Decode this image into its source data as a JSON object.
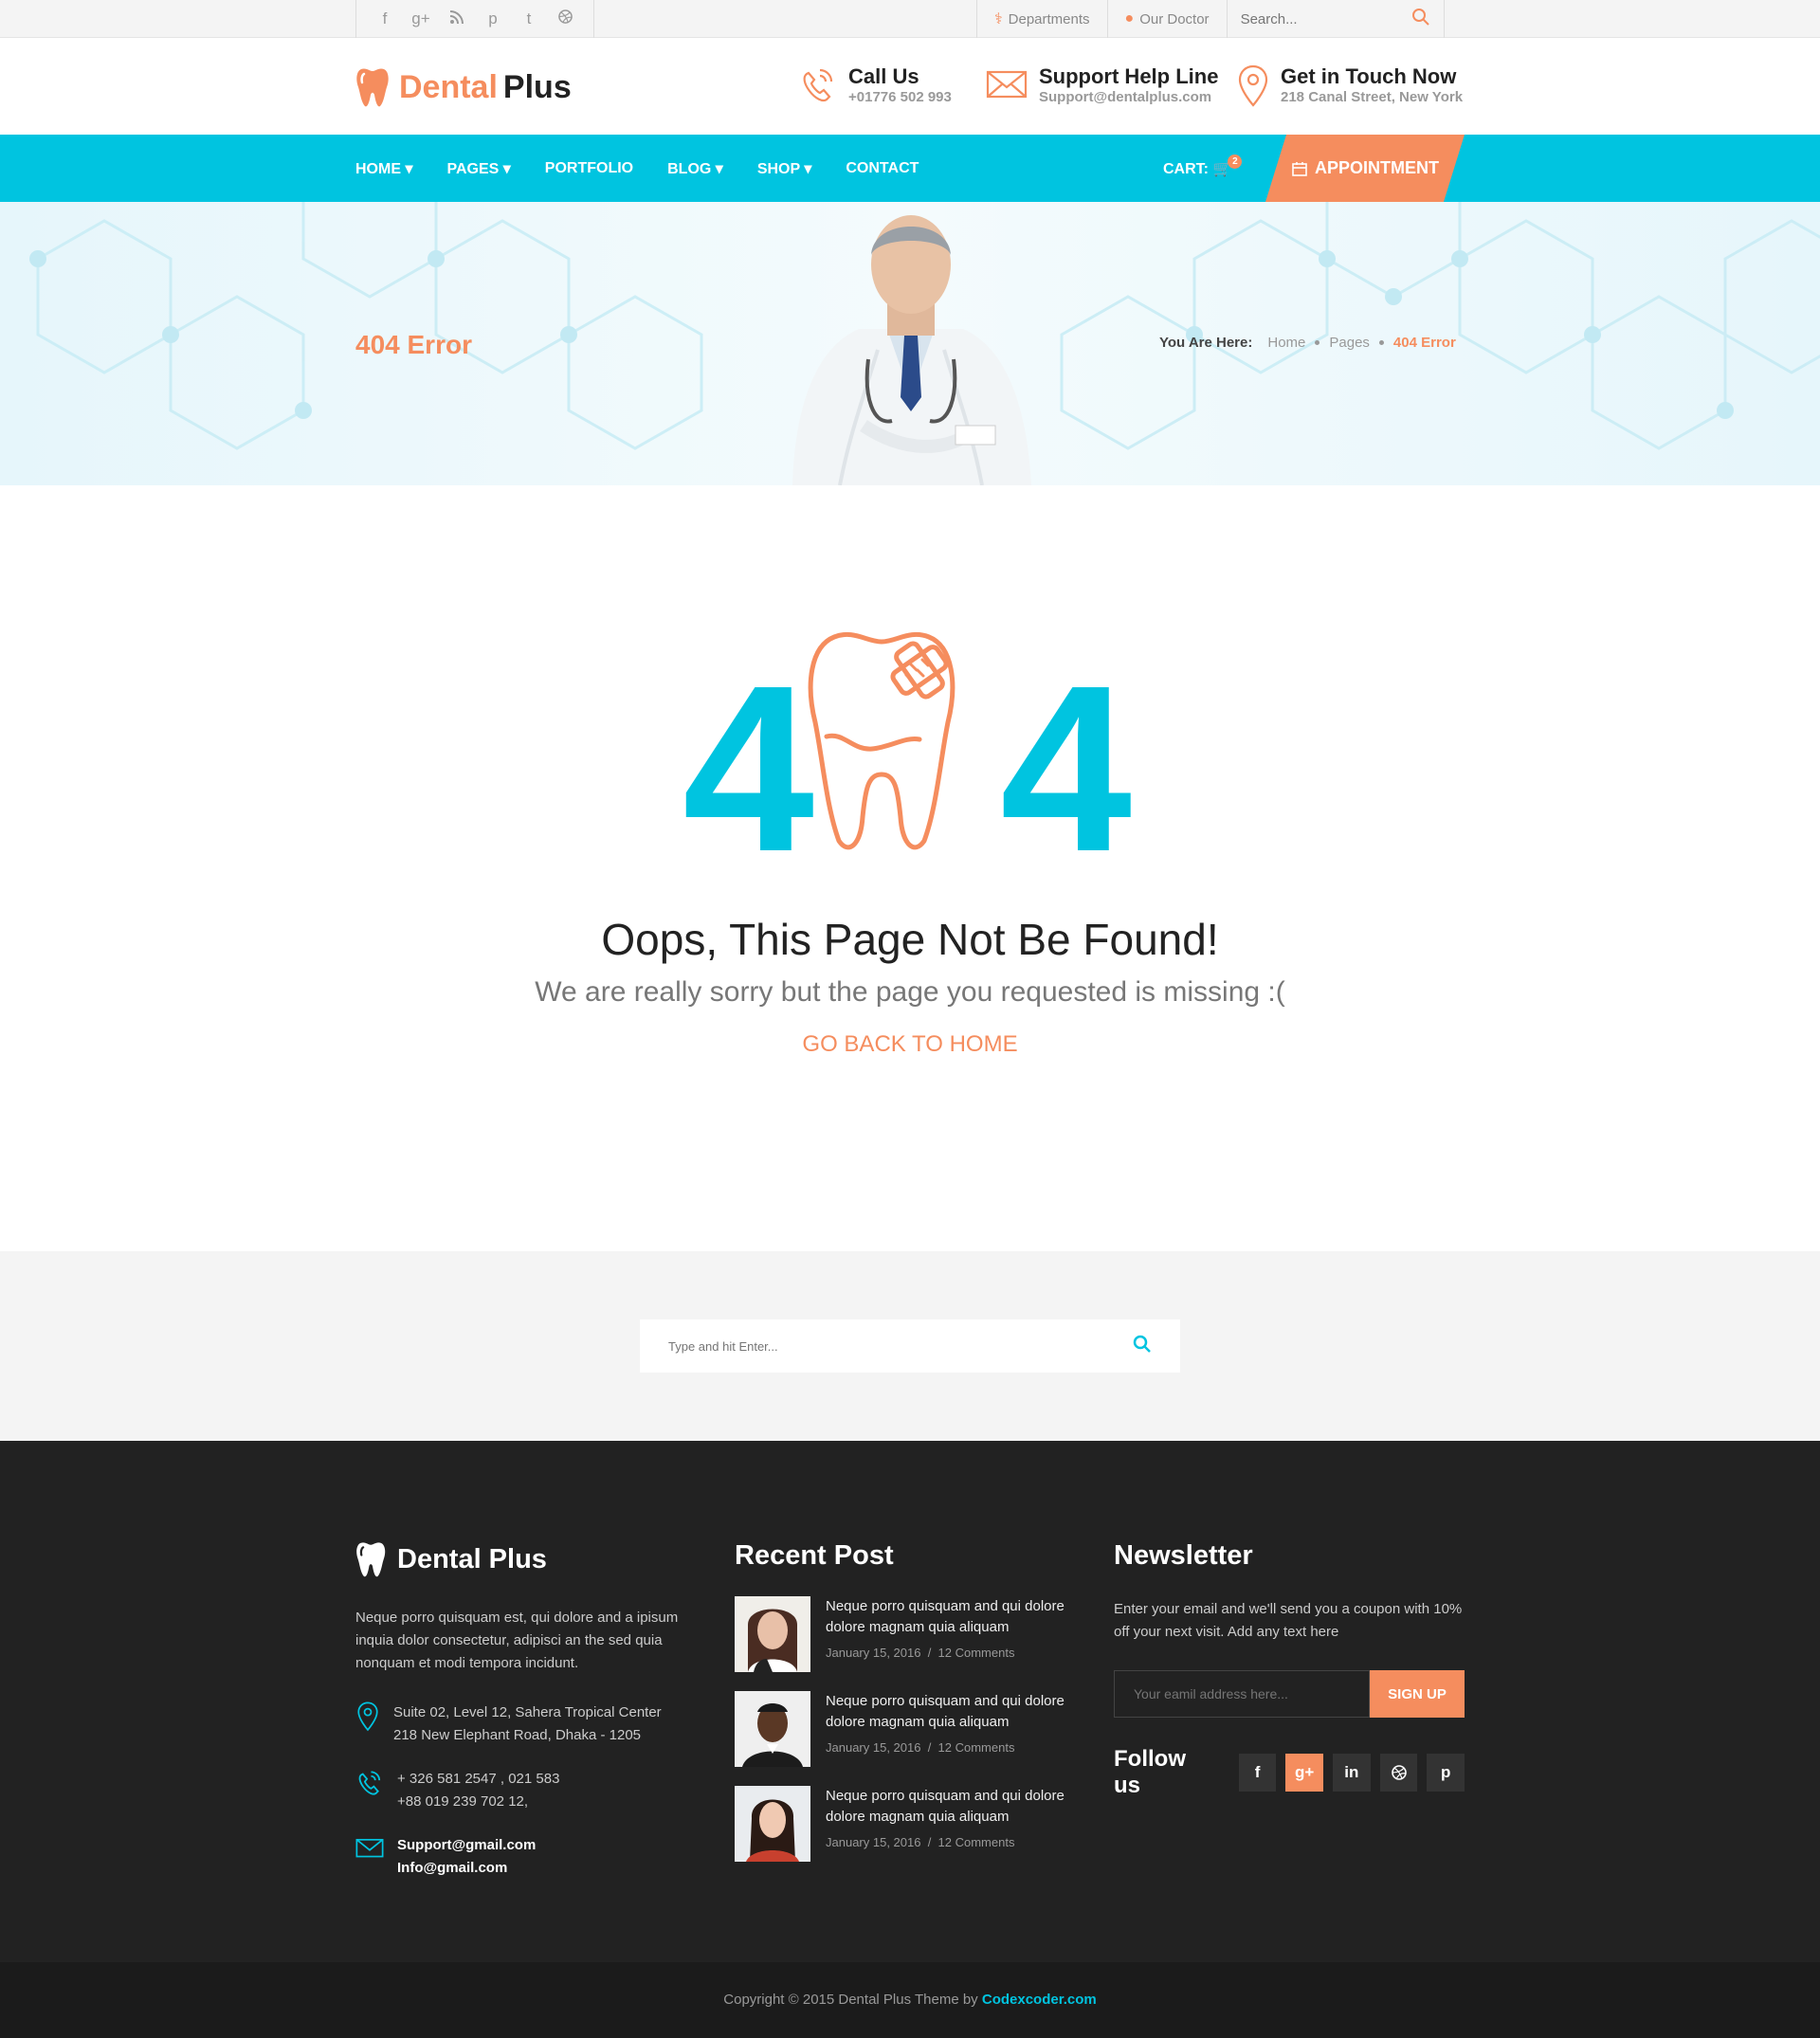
{
  "topbar": {
    "social": [
      "f",
      "g+",
      "rss",
      "p",
      "t",
      "d"
    ],
    "links": [
      {
        "label": "Departments",
        "icon": "stethoscope-icon"
      },
      {
        "label": "Our Doctor",
        "icon": "user-icon"
      }
    ],
    "search_placeholder": "Search..."
  },
  "header": {
    "logo_part1": "Dental",
    "logo_part2": "Plus",
    "info": [
      {
        "title": "Call Us",
        "sub": "+01776 502 993"
      },
      {
        "title": "Support Help Line",
        "sub": "Support@dentalplus.com"
      },
      {
        "title": "Get in Touch Now",
        "sub": "218 Canal Street, New York"
      }
    ]
  },
  "nav": {
    "items": [
      "HOME",
      "PAGES",
      "PORTFOLIO",
      "BLOG",
      "SHOP",
      "CONTACT"
    ],
    "cart_label": "CART:",
    "cart_count": "2",
    "appointment": "APPOINTMENT"
  },
  "banner": {
    "title": "404 Error",
    "crumb_lead": "You Are Here:",
    "crumbs": [
      "Home",
      "Pages",
      "404 Error"
    ]
  },
  "error": {
    "digit_left": "4",
    "digit_right": "4",
    "heading": "Oops, This Page Not Be Found!",
    "sub": "We are really sorry but the page you requested is missing :(",
    "back": "GO BACK TO HOME"
  },
  "search_band": {
    "placeholder": "Type and hit Enter..."
  },
  "footer": {
    "brand": "Dental Plus",
    "about": "Neque porro quisquam est, qui dolore and a ipisum inquia dolor consectetur, adipisci an the sed quia nonquam et modi tempora incidunt.",
    "address_1": "Suite 02, Level 12, Sahera Tropical Center",
    "address_2": "218 New Elephant Road, Dhaka - 1205",
    "phone_1": "+ 326 581 2547 , 021 583",
    "phone_2": "+88 019 239 702 12,",
    "email_1": "Support@gmail.com",
    "email_2": "Info@gmail.com",
    "recent_title": "Recent Post",
    "posts": [
      {
        "title": "Neque porro quisquam and qui dolore dolore magnam quia aliquam",
        "date": "January 15, 2016",
        "comments": "12 Comments"
      },
      {
        "title": "Neque porro quisquam and qui dolore dolore magnam quia aliquam",
        "date": "January 15, 2016",
        "comments": "12 Comments"
      },
      {
        "title": "Neque porro quisquam and qui dolore dolore magnam quia aliquam",
        "date": "January 15, 2016",
        "comments": "12 Comments"
      }
    ],
    "newsletter_title": "Newsletter",
    "newsletter_text": "Enter your email and we'll send you a coupon with 10% off your next visit. Add any text here",
    "email_placeholder": "Your eamil address here...",
    "signup": "SIGN UP",
    "follow": "Follow us",
    "follow_icons": [
      "f",
      "g+",
      "in",
      "d",
      "p"
    ]
  },
  "copyright": {
    "text": "Copyright © 2015 Dental Plus Theme by",
    "brand": "Codexcoder.com"
  },
  "colors": {
    "accent": "#f58d5e",
    "primary": "#00c4e0",
    "footer_bg": "#222222"
  }
}
